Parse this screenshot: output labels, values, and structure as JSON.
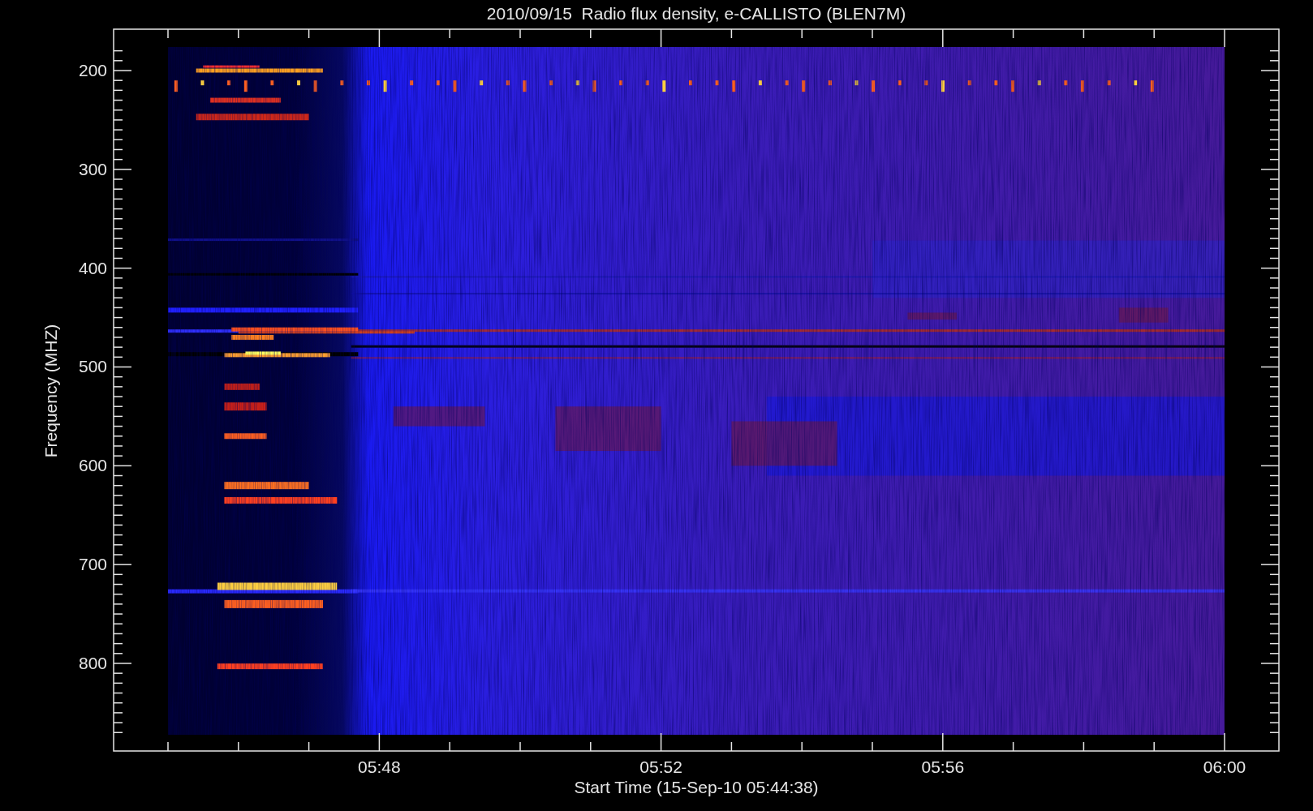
{
  "title": "2010/09/15  Radio flux density, e-CALLISTO (BLEN7M)",
  "y_axis": {
    "label": "Frequency (MHZ)",
    "tick_labels": [
      "200",
      "300",
      "400",
      "500",
      "600",
      "700",
      "800"
    ]
  },
  "x_axis": {
    "label": "Start Time (15-Sep-10 05:44:38)",
    "tick_labels": [
      "05:48",
      "05:52",
      "05:56",
      "06:00"
    ]
  }
}
